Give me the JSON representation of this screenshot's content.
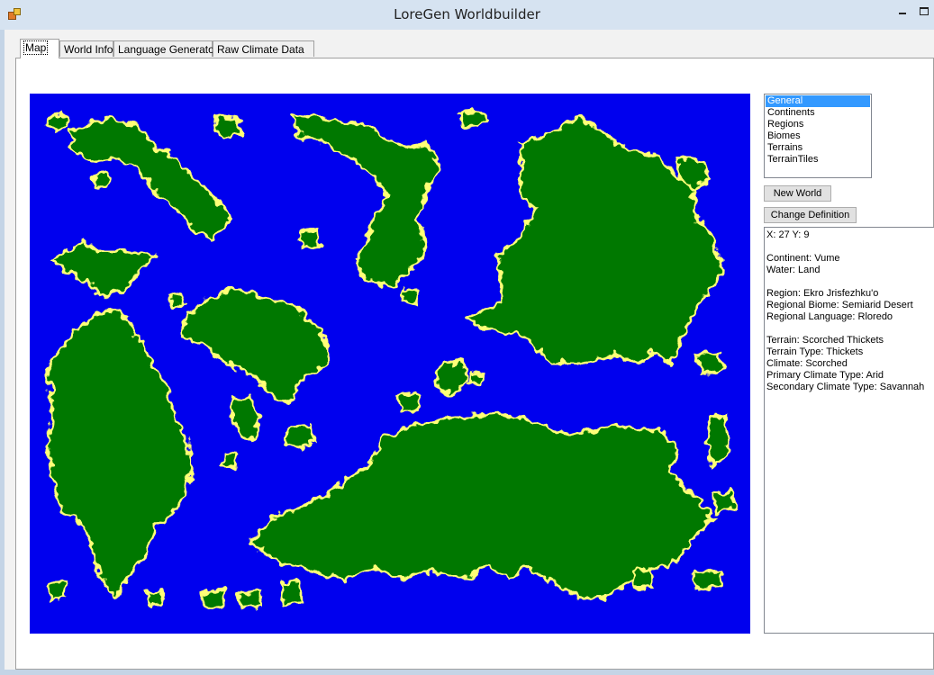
{
  "window": {
    "title": "LoreGen Worldbuilder",
    "icon": "app-icon"
  },
  "tabs": [
    {
      "label": "Map",
      "active": true
    },
    {
      "label": "World Info",
      "active": false
    },
    {
      "label": "Language Generator",
      "active": false
    },
    {
      "label": "Raw Climate Data",
      "active": false
    }
  ],
  "map": {
    "colors": {
      "water": "#0000ee",
      "land": "#007800",
      "coast": "#ffff77"
    }
  },
  "category_list": {
    "items": [
      "General",
      "Continents",
      "Regions",
      "Biomes",
      "Terrains",
      "TerrainTiles"
    ],
    "selected": "General"
  },
  "buttons": {
    "new_world": "New World",
    "change_definition": "Change Definition"
  },
  "info": {
    "coordinates": "X: 27 Y: 9",
    "continent": "Continent: Vume",
    "water": "Water: Land",
    "region": "Region: Ekro Jrisfezhku'o",
    "regional_biome": "Regional Biome: Semiarid Desert",
    "regional_language": "Regional Language: Rloredo",
    "terrain": "Terrain: Scorched Thickets",
    "terrain_type": "Terrain Type: Thickets",
    "climate": "Climate: Scorched",
    "primary_climate": "Primary Climate Type: Arid",
    "secondary_climate": "Secondary Climate Type: Savannah"
  }
}
